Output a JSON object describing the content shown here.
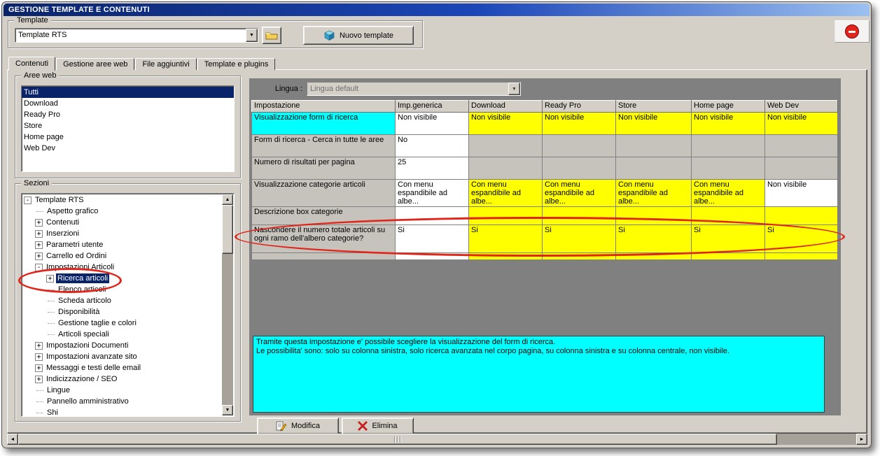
{
  "window": {
    "title": "GESTIONE TEMPLATE E CONTENUTI"
  },
  "template_group": {
    "label": "Template",
    "selected_template": "Template RTS",
    "new_template_label": "Nuovo template"
  },
  "tabs": [
    {
      "label": "Contenuti",
      "active": true
    },
    {
      "label": "Gestione aree web",
      "active": false
    },
    {
      "label": "File aggiuntivi",
      "active": false
    },
    {
      "label": "Template e plugins",
      "active": false
    }
  ],
  "aree_web": {
    "label": "Aree web",
    "selected": "Tutti",
    "items": [
      "Tutti",
      "Download",
      "Ready Pro",
      "Store",
      "Home page",
      "Web Dev"
    ]
  },
  "sezioni": {
    "label": "Sezioni",
    "items": [
      {
        "label": "Template RTS",
        "level": 0,
        "expand": "minus",
        "selected": false
      },
      {
        "label": "Aspetto grafico",
        "level": 1,
        "expand": "none",
        "selected": false
      },
      {
        "label": "Contenuti",
        "level": 1,
        "expand": "plus",
        "selected": false
      },
      {
        "label": "Inserzioni",
        "level": 1,
        "expand": "plus",
        "selected": false
      },
      {
        "label": "Parametri utente",
        "level": 1,
        "expand": "plus",
        "selected": false
      },
      {
        "label": "Carrello ed Ordini",
        "level": 1,
        "expand": "plus",
        "selected": false
      },
      {
        "label": "Impostazioni Articoli",
        "level": 1,
        "expand": "minus",
        "selected": false
      },
      {
        "label": "Ricerca articoli",
        "level": 2,
        "expand": "plus",
        "selected": true
      },
      {
        "label": "Elenco articoli",
        "level": 2,
        "expand": "none",
        "selected": false
      },
      {
        "label": "Scheda articolo",
        "level": 2,
        "expand": "none",
        "selected": false
      },
      {
        "label": "Disponibilità",
        "level": 2,
        "expand": "none",
        "selected": false
      },
      {
        "label": "Gestione taglie e colori",
        "level": 2,
        "expand": "none",
        "selected": false
      },
      {
        "label": "Articoli speciali",
        "level": 2,
        "expand": "none",
        "selected": false
      },
      {
        "label": "Impostazioni Documenti",
        "level": 1,
        "expand": "plus",
        "selected": false
      },
      {
        "label": "Impostazioni avanzate sito",
        "level": 1,
        "expand": "plus",
        "selected": false
      },
      {
        "label": "Messaggi e testi delle email",
        "level": 1,
        "expand": "plus",
        "selected": false
      },
      {
        "label": "Indicizzazione / SEO",
        "level": 1,
        "expand": "plus",
        "selected": false
      },
      {
        "label": "Lingue",
        "level": 1,
        "expand": "none",
        "selected": false
      },
      {
        "label": "Pannello amministrativo",
        "level": 1,
        "expand": "none",
        "selected": false
      },
      {
        "label": "Shi",
        "level": 1,
        "expand": "none",
        "selected": false
      }
    ]
  },
  "lingua": {
    "label": "Lingua :",
    "value": "Lingua default"
  },
  "settings_table": {
    "columns": [
      "Impostazione",
      "Imp.generica",
      "Download",
      "Ready Pro",
      "Store",
      "Home page",
      "Web Dev"
    ],
    "rows": [
      {
        "label": "Visualizzazione form di ricerca",
        "label_bg": "cyan",
        "cells": [
          {
            "text": "Non visibile",
            "bg": "white"
          },
          {
            "text": "Non visibile",
            "bg": "yellow"
          },
          {
            "text": "Non visibile",
            "bg": "yellow"
          },
          {
            "text": "Non visibile",
            "bg": "yellow"
          },
          {
            "text": "Non visibile",
            "bg": "yellow"
          },
          {
            "text": "Non visibile",
            "bg": "yellow"
          }
        ]
      },
      {
        "label": "Form di ricerca - Cerca in tutte le aree",
        "label_bg": "gray",
        "cells": [
          {
            "text": "No",
            "bg": "white"
          },
          {
            "text": "",
            "bg": "gray"
          },
          {
            "text": "",
            "bg": "gray"
          },
          {
            "text": "",
            "bg": "gray"
          },
          {
            "text": "",
            "bg": "gray"
          },
          {
            "text": "",
            "bg": "gray"
          }
        ]
      },
      {
        "label": "Numero di risultati per pagina",
        "label_bg": "gray",
        "cells": [
          {
            "text": "25",
            "bg": "white"
          },
          {
            "text": "",
            "bg": "gray"
          },
          {
            "text": "",
            "bg": "gray"
          },
          {
            "text": "",
            "bg": "gray"
          },
          {
            "text": "",
            "bg": "gray"
          },
          {
            "text": "",
            "bg": "gray"
          }
        ]
      },
      {
        "label": "Visualizzazione categorie articoli",
        "label_bg": "gray",
        "cells": [
          {
            "text": "Con menu espandibile ad albe...",
            "bg": "white"
          },
          {
            "text": "Con menu espandibile ad albe...",
            "bg": "yellow"
          },
          {
            "text": "Con menu espandibile ad albe...",
            "bg": "yellow"
          },
          {
            "text": "Con menu espandibile ad albe...",
            "bg": "yellow"
          },
          {
            "text": "Con menu espandibile ad albe...",
            "bg": "yellow"
          },
          {
            "text": "Non visibile",
            "bg": "white"
          }
        ]
      },
      {
        "label": "Descrizione box categorie",
        "label_bg": "gray",
        "cells": [
          {
            "text": "",
            "bg": "white"
          },
          {
            "text": "",
            "bg": "yellow"
          },
          {
            "text": "",
            "bg": "yellow"
          },
          {
            "text": "",
            "bg": "yellow"
          },
          {
            "text": "",
            "bg": "yellow"
          },
          {
            "text": "",
            "bg": "yellow"
          }
        ]
      },
      {
        "label": "Nascondere il numero totale articoli su ogni ramo dell'albero categorie?",
        "label_bg": "gray",
        "cells": [
          {
            "text": "Si",
            "bg": "white"
          },
          {
            "text": "Si",
            "bg": "yellow"
          },
          {
            "text": "Si",
            "bg": "yellow"
          },
          {
            "text": "Si",
            "bg": "yellow"
          },
          {
            "text": "Si",
            "bg": "yellow"
          },
          {
            "text": "Si",
            "bg": "yellow"
          }
        ]
      },
      {
        "label": "",
        "label_bg": "gray",
        "cells": [
          {
            "text": "",
            "bg": "white"
          },
          {
            "text": "",
            "bg": "yellow"
          },
          {
            "text": "",
            "bg": "yellow"
          },
          {
            "text": "",
            "bg": "yellow"
          },
          {
            "text": "",
            "bg": "yellow"
          },
          {
            "text": "",
            "bg": "yellow"
          }
        ]
      }
    ]
  },
  "info_box": {
    "line1": "Tramite questa impostazione e' possibile scegliere la visualizzazione del form di ricerca.",
    "line2": "Le possibilita' sono: solo su colonna sinistra, solo ricerca avanzata nel corpo pagina, su colonna sinistra e su colonna centrale, non visibile."
  },
  "actions": {
    "modifica": "Modifica",
    "elimina": "Elimina"
  },
  "icons": {
    "combo_arrow": "▼",
    "scroll_up": "▲",
    "scroll_down": "▼",
    "scroll_left": "◄",
    "scroll_right": "►",
    "tree_collapse": "-",
    "tree_expand": "+"
  },
  "colors": {
    "selection_blue": "#0A246A",
    "highlight_yellow": "#FFFF00",
    "highlight_cyan": "#00FFFF",
    "annotation_red": "#E1251B"
  }
}
